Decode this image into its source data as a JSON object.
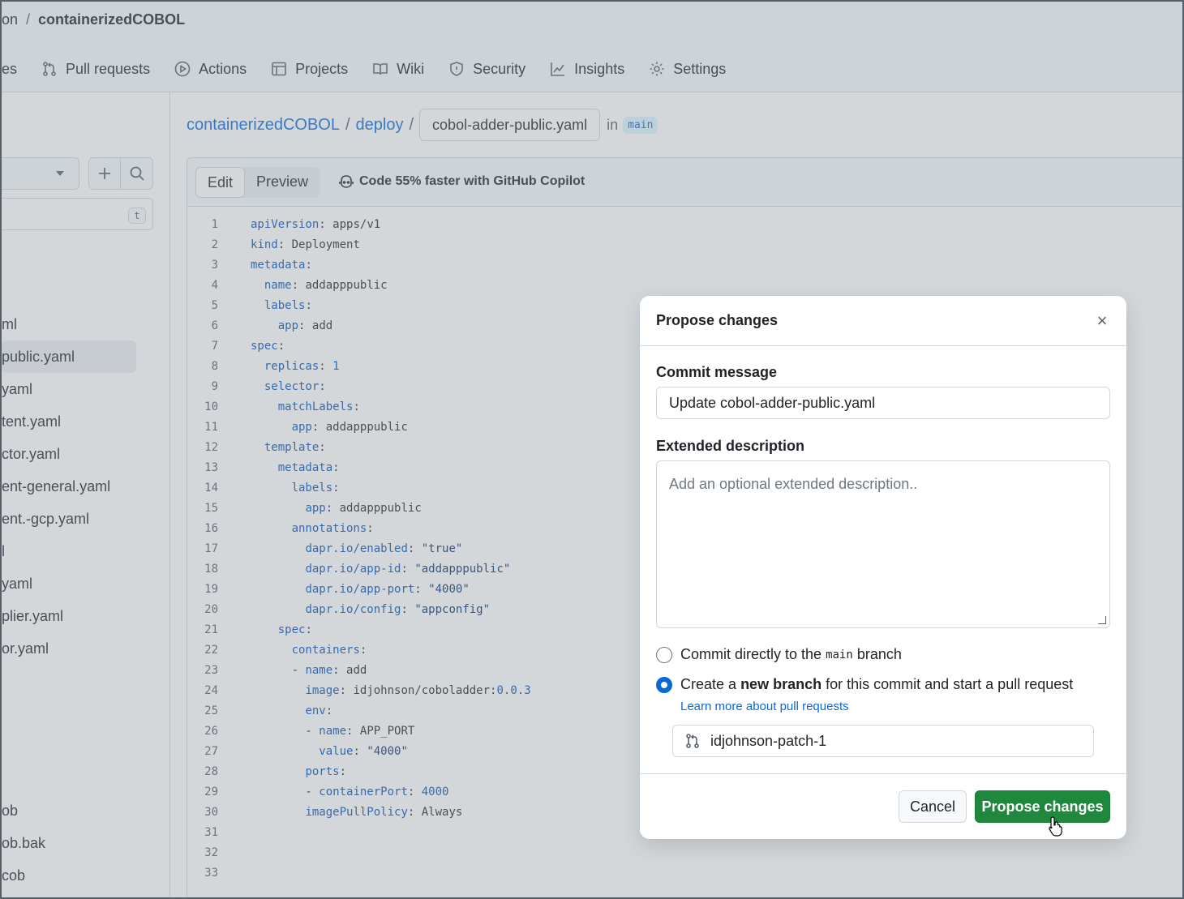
{
  "header": {
    "breadcrumb_owner": "on",
    "breadcrumb_sep": "/",
    "repo": "containerizedCOBOL"
  },
  "nav": {
    "items": [
      {
        "label": "es",
        "icon": "none"
      },
      {
        "label": "Pull requests",
        "icon": "git-pull-request-icon"
      },
      {
        "label": "Actions",
        "icon": "play-icon"
      },
      {
        "label": "Projects",
        "icon": "table-icon"
      },
      {
        "label": "Wiki",
        "icon": "book-icon"
      },
      {
        "label": "Security",
        "icon": "shield-icon"
      },
      {
        "label": "Insights",
        "icon": "graph-icon"
      },
      {
        "label": "Settings",
        "icon": "gear-icon"
      }
    ]
  },
  "sidebar": {
    "filter_shortcut": "t",
    "files": [
      "ml",
      "public.yaml",
      "yaml",
      "tent.yaml",
      "ctor.yaml",
      "ent-general.yaml",
      "ent.-gcp.yaml",
      "l",
      "yaml",
      "plier.yaml",
      "or.yaml"
    ],
    "active_index": 1,
    "files_bottom": [
      "ob",
      "ob.bak",
      "cob"
    ]
  },
  "path": {
    "repo": "containerizedCOBOL",
    "dir": "deploy",
    "filename": "cobol-adder-public.yaml",
    "in_label": "in",
    "branch": "main"
  },
  "editor": {
    "tab_edit": "Edit",
    "tab_preview": "Preview",
    "copilot": "Code 55% faster with GitHub Copilot",
    "lines": [
      {
        "n": "1",
        "indent": "",
        "k": "apiVersion",
        "v": "apps/v1",
        "t": "val"
      },
      {
        "n": "2",
        "indent": "",
        "k": "kind",
        "v": "Deployment",
        "t": "val"
      },
      {
        "n": "3",
        "indent": "",
        "k": "metadata",
        "v": "",
        "t": "val"
      },
      {
        "n": "4",
        "indent": "  ",
        "k": "name",
        "v": "addapppublic",
        "t": "val"
      },
      {
        "n": "5",
        "indent": "  ",
        "k": "labels",
        "v": "",
        "t": "val"
      },
      {
        "n": "6",
        "indent": "    ",
        "k": "app",
        "v": "add",
        "t": "val"
      },
      {
        "n": "7",
        "indent": "",
        "k": "spec",
        "v": "",
        "t": "val"
      },
      {
        "n": "8",
        "indent": "  ",
        "k": "replicas",
        "v": "1",
        "t": "num"
      },
      {
        "n": "9",
        "indent": "  ",
        "k": "selector",
        "v": "",
        "t": "val"
      },
      {
        "n": "10",
        "indent": "    ",
        "k": "matchLabels",
        "v": "",
        "t": "val"
      },
      {
        "n": "11",
        "indent": "      ",
        "k": "app",
        "v": "addapppublic",
        "t": "val"
      },
      {
        "n": "12",
        "indent": "  ",
        "k": "template",
        "v": "",
        "t": "val"
      },
      {
        "n": "13",
        "indent": "    ",
        "k": "metadata",
        "v": "",
        "t": "val"
      },
      {
        "n": "14",
        "indent": "      ",
        "k": "labels",
        "v": "",
        "t": "val"
      },
      {
        "n": "15",
        "indent": "        ",
        "k": "app",
        "v": "addapppublic",
        "t": "val"
      },
      {
        "n": "16",
        "indent": "      ",
        "k": "annotations",
        "v": "",
        "t": "val"
      },
      {
        "n": "17",
        "indent": "        ",
        "k": "dapr.io/enabled",
        "v": "\"true\"",
        "t": "str"
      },
      {
        "n": "18",
        "indent": "        ",
        "k": "dapr.io/app-id",
        "v": "\"addapppublic\"",
        "t": "str"
      },
      {
        "n": "19",
        "indent": "        ",
        "k": "dapr.io/app-port",
        "v": "\"4000\"",
        "t": "str"
      },
      {
        "n": "20",
        "indent": "        ",
        "k": "dapr.io/config",
        "v": "\"appconfig\"",
        "t": "str"
      },
      {
        "n": "21",
        "indent": "    ",
        "k": "spec",
        "v": "",
        "t": "val"
      },
      {
        "n": "22",
        "indent": "      ",
        "k": "containers",
        "v": "",
        "t": "val"
      },
      {
        "n": "23",
        "indent": "      - ",
        "k": "name",
        "v": "add",
        "t": "val"
      },
      {
        "n": "24",
        "indent": "        ",
        "k": "image",
        "v": "idjohnson/coboladder:",
        "t": "val",
        "extra": "0.0.3"
      },
      {
        "n": "25",
        "indent": "        ",
        "k": "env",
        "v": "",
        "t": "val"
      },
      {
        "n": "26",
        "indent": "        - ",
        "k": "name",
        "v": "APP_PORT",
        "t": "val"
      },
      {
        "n": "27",
        "indent": "          ",
        "k": "value",
        "v": "\"4000\"",
        "t": "str"
      },
      {
        "n": "28",
        "indent": "        ",
        "k": "ports",
        "v": "",
        "t": "val"
      },
      {
        "n": "29",
        "indent": "        - ",
        "k": "containerPort",
        "v": "4000",
        "t": "num"
      },
      {
        "n": "30",
        "indent": "        ",
        "k": "imagePullPolicy",
        "v": "Always",
        "t": "val"
      },
      {
        "n": "31",
        "indent": "",
        "k": "",
        "v": "",
        "t": "val"
      },
      {
        "n": "32",
        "indent": "",
        "k": "",
        "v": "",
        "t": "val"
      },
      {
        "n": "33",
        "indent": "",
        "k": "",
        "v": "",
        "t": "val"
      }
    ]
  },
  "dialog": {
    "title": "Propose changes",
    "close": "×",
    "commit_label": "Commit message",
    "commit_value": "Update cobol-adder-public.yaml",
    "desc_label": "Extended description",
    "desc_placeholder": "Add an optional extended description..",
    "option1_pre": "Commit directly to the",
    "option1_branch": "main",
    "option1_post": "branch",
    "option2_pre": "Create a",
    "option2_bold": "new branch",
    "option2_post": "for this commit and start a pull request",
    "learn_more": "Learn more about pull requests",
    "new_branch": "idjohnson-patch-1",
    "cancel": "Cancel",
    "propose": "Propose changes"
  },
  "colors": {
    "accent": "#0969da",
    "primary_button": "#1f883d",
    "overlay": "#8c959f"
  }
}
